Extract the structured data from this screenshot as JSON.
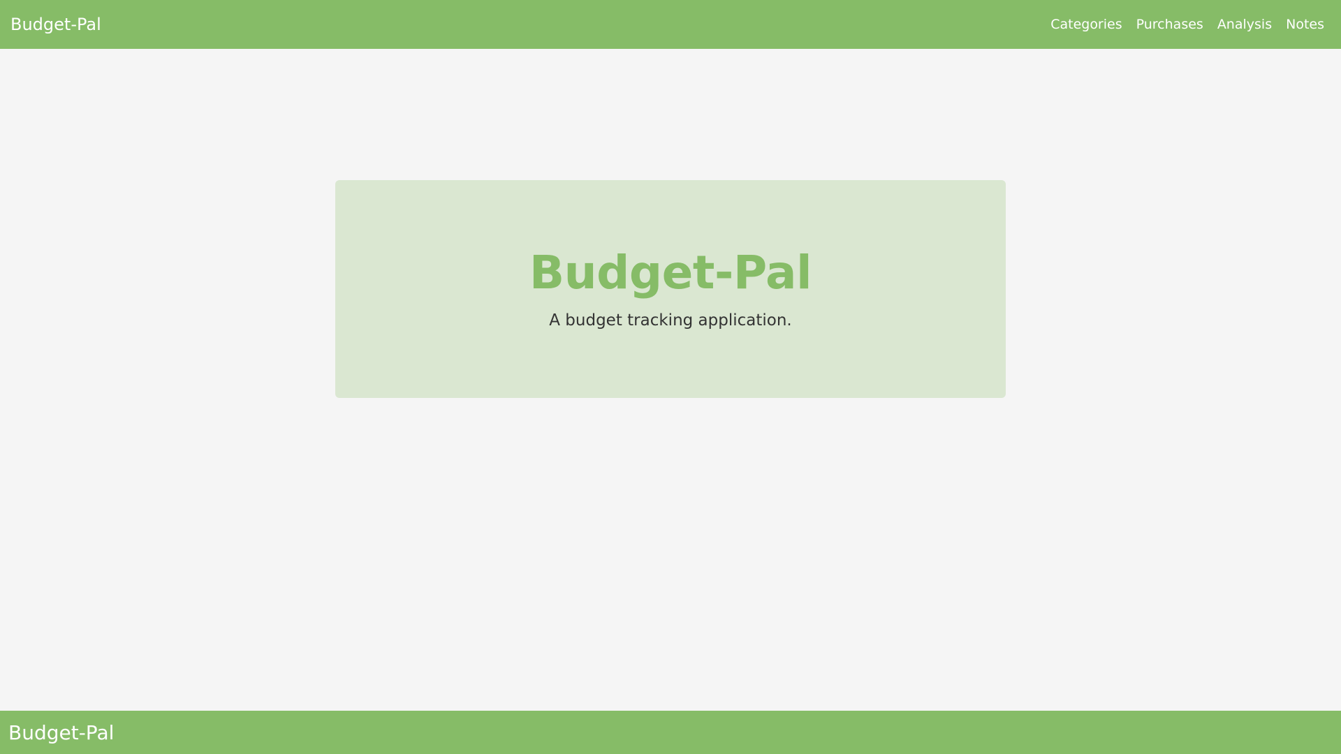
{
  "theme": {
    "accent": "#86bc67",
    "hero_background": "#dae7d1",
    "page_background": "#f5f5f5"
  },
  "navbar": {
    "brand": "Budget-Pal",
    "links": [
      "Categories",
      "Purchases",
      "Analysis",
      "Notes"
    ]
  },
  "hero": {
    "title": "Budget-Pal",
    "subtitle": "A budget tracking application."
  },
  "footer": {
    "brand": "Budget-Pal"
  }
}
